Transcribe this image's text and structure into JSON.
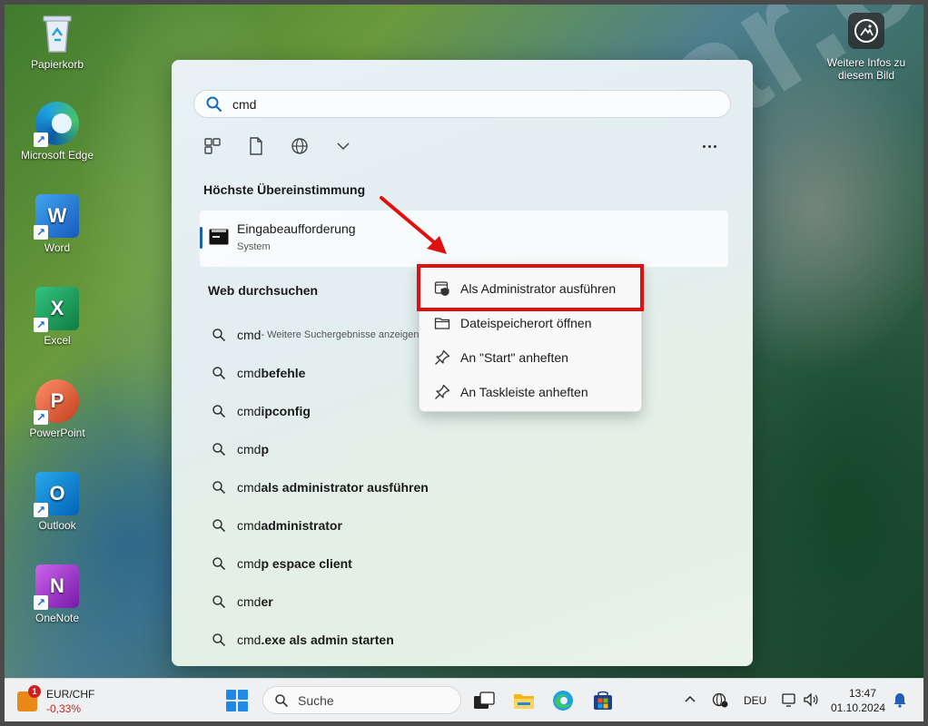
{
  "desktop": {
    "icons": [
      {
        "label": "Papierkorb",
        "icon": "recycle-bin-icon"
      },
      {
        "label": "Microsoft Edge",
        "icon": "edge-icon"
      },
      {
        "label": "Word",
        "icon": "word-icon",
        "letter": "W"
      },
      {
        "label": "Excel",
        "icon": "excel-icon",
        "letter": "X"
      },
      {
        "label": "PowerPoint",
        "icon": "powerpoint-icon",
        "letter": "P"
      },
      {
        "label": "Outlook",
        "icon": "outlook-icon",
        "letter": "O"
      },
      {
        "label": "OneNote",
        "icon": "onenote-icon",
        "letter": "N"
      }
    ],
    "info_widget": {
      "line1": "Weitere Infos zu",
      "line2": "diesem Bild"
    },
    "watermark": "zenzstar.c"
  },
  "start_menu": {
    "search": {
      "value": "cmd"
    },
    "filters": [
      {
        "icon": "apps-filter-icon"
      },
      {
        "icon": "documents-filter-icon"
      },
      {
        "icon": "web-filter-icon"
      },
      {
        "icon": "chevron-down-icon"
      }
    ],
    "more_icon": "more-options-icon",
    "best_match": {
      "heading": "Höchste Übereinstimmung",
      "title": "Eingabeaufforderung",
      "subtitle": "System",
      "icon": "command-prompt-icon"
    },
    "web": {
      "heading": "Web durchsuchen",
      "items": [
        {
          "prefix": "cmd",
          "rest": "",
          "suffix": " - Weitere Suchergebnisse anzeigen"
        },
        {
          "prefix": "cmd ",
          "rest": "befehle",
          "suffix": ""
        },
        {
          "prefix": "cmd ",
          "rest": "ipconfig",
          "suffix": ""
        },
        {
          "prefix": "cmd",
          "rest": "p",
          "suffix": ""
        },
        {
          "prefix": "cmd ",
          "rest": "als administrator ausführen",
          "suffix": ""
        },
        {
          "prefix": "cmd ",
          "rest": "administrator",
          "suffix": ""
        },
        {
          "prefix": "cmd",
          "rest": "p espace client",
          "suffix": ""
        },
        {
          "prefix": "cmd",
          "rest": "er",
          "suffix": ""
        },
        {
          "prefix": "cmd",
          "rest": ".exe als admin starten",
          "suffix": ""
        }
      ]
    }
  },
  "context_menu": {
    "items": [
      {
        "label": "Als Administrator ausführen",
        "icon": "shield-icon"
      },
      {
        "label": "Dateispeicherort öffnen",
        "icon": "folder-icon"
      },
      {
        "label": "An \"Start\" anheften",
        "icon": "pin-icon"
      },
      {
        "label": "An Taskleiste anheften",
        "icon": "pin-icon"
      }
    ],
    "highlight_color": "#e01010"
  },
  "taskbar": {
    "widget": {
      "badge": "1",
      "pair": "EUR/CHF",
      "delta": "-0,33%",
      "delta_color": "#c42b1c"
    },
    "search_label": "Suche",
    "apps": [
      "task-view-icon",
      "file-explorer-icon",
      "edge-icon",
      "microsoft-store-icon"
    ],
    "tray": {
      "language": "DEU",
      "time": "13:47",
      "date": "01.10.2024"
    }
  },
  "colors": {
    "accent": "#1a5fb4",
    "windows_blue": "#1f8ae6"
  }
}
